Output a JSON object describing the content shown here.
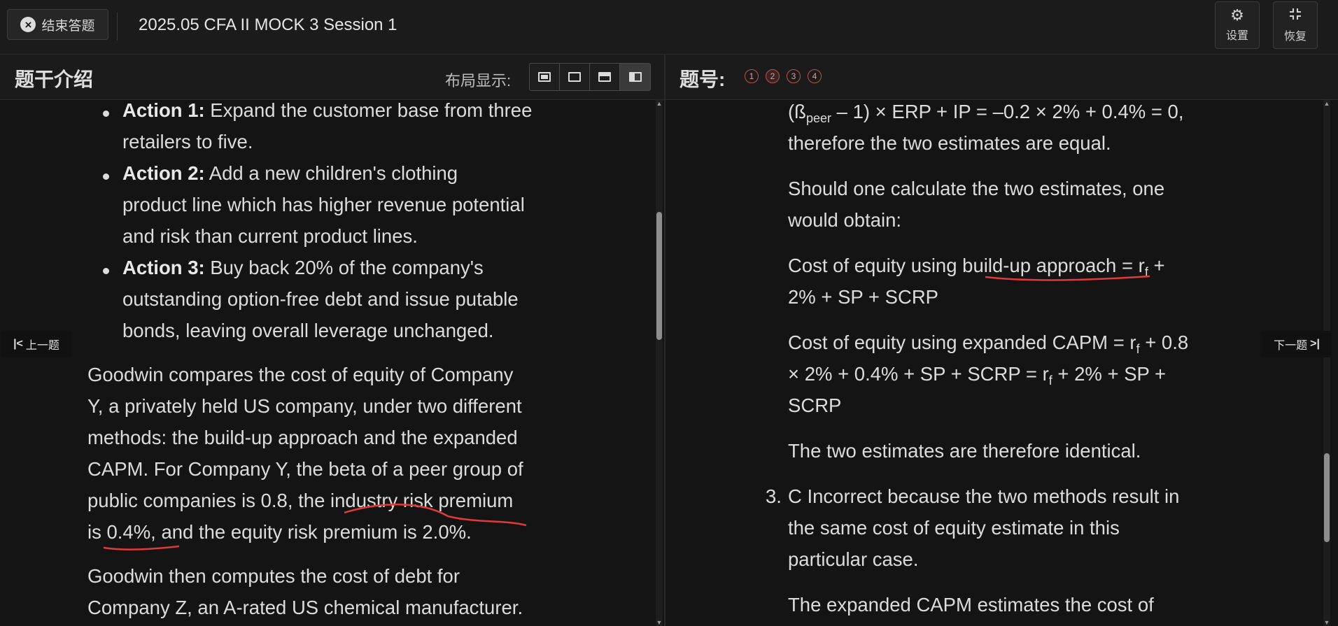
{
  "topbar": {
    "exit_label": "结束答题",
    "title": "2025.05 CFA II MOCK 3 Session 1",
    "settings_label": "设置",
    "restore_label": "恢复"
  },
  "left_panel": {
    "title": "题干介绍",
    "layout_label": "布局显示:",
    "bullets": [
      {
        "head": "Action 1:",
        "lines": [
          " Expand the customer base from three",
          "retailers to five."
        ]
      },
      {
        "head": "Action 2:",
        "lines": [
          " Add a new children's clothing",
          "product line which has higher revenue potential",
          "and risk than current product lines."
        ]
      },
      {
        "head": "Action 3:",
        "lines": [
          " Buy back 20% of the company's",
          "outstanding option-free debt and issue putable",
          "bonds, leaving overall leverage unchanged."
        ]
      }
    ],
    "paragraph1": [
      "Goodwin compares the cost of equity of Company",
      "Y, a privately held US company, under two different",
      "methods: the build-up approach and the expanded",
      "CAPM. For Company Y, the beta of a peer group of",
      "public companies is 0.8, the industry risk premium",
      "is 0.4%, and the equity risk premium is 2.0%."
    ],
    "paragraph2": [
      "Goodwin then computes the cost of debt for",
      "Company Z, an A-rated US chemical manufacturer."
    ]
  },
  "right_panel": {
    "title": "题号:",
    "question_numbers": [
      "1",
      "2",
      "3",
      "4"
    ],
    "line1": {
      "pre": "(ß",
      "sub": "peer",
      "post": " – 1) × ERP + IP = –0.2 × 2% + 0.4% = 0,"
    },
    "line2": "therefore the two estimates are equal.",
    "para_a": [
      "Should one calculate the two estimates, one",
      "would obtain:"
    ],
    "buildup": {
      "pre": "Cost of equity using ",
      "underlined": "build-up approach",
      "mid": " = r",
      "sub": "f",
      "post": " +",
      "line2": "2% + SP + SCRP"
    },
    "capm": {
      "l1_pre": "Cost of equity using expanded CAPM = r",
      "l1_sub": "f",
      "l1_post": " + 0.8",
      "l2_pre": "× 2% + 0.4% + SP + SCRP = r",
      "l2_sub": "f",
      "l2_post": " + 2% + SP +",
      "l3": "SCRP"
    },
    "identical": "The two estimates are therefore identical.",
    "item3_number": "3.",
    "item3": [
      "C Incorrect because the two methods result in",
      "the same cost of equity estimate in this",
      "particular case."
    ],
    "last": "The expanded CAPM estimates the cost of"
  },
  "nav": {
    "prev": "上一题",
    "next": "下一题"
  }
}
